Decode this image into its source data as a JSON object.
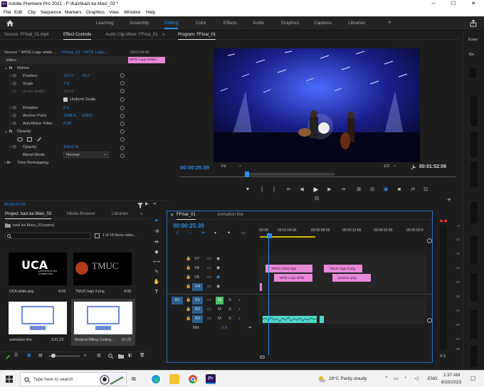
{
  "window": {
    "title": "Adobe Premiere Pro 2021 - F:\\Kazi\\kazi ka Masi_03 *",
    "app_icon": "Pr",
    "controls": [
      "─",
      "☐",
      "✕"
    ]
  },
  "menu": [
    "File",
    "Edit",
    "Clip",
    "Sequence",
    "Markers",
    "Graphics",
    "View",
    "Window",
    "Help"
  ],
  "workspaces": [
    {
      "label": "Learning"
    },
    {
      "label": "Assembly"
    },
    {
      "label": "Editing",
      "active": true
    },
    {
      "label": "Color"
    },
    {
      "label": "Effects"
    },
    {
      "label": "Audio"
    },
    {
      "label": "Graphics"
    },
    {
      "label": "Captions"
    },
    {
      "label": "Libraries"
    }
  ],
  "ws_more": "»",
  "ec": {
    "tabs": [
      "Source: FFinal_01.mp4",
      "Effect Controls",
      "Audio Clip Mixer: FFinal_01"
    ],
    "tabs_more": "»",
    "source": "Source * MITE Logo white ...",
    "sequence": "FFinal_01 * MITE Logo...",
    "tc_head": "00:01:04:00",
    "clip_chip": "MITE Logo white l",
    "video_label": "Video",
    "motion": "Motion",
    "position": {
      "label": "Position",
      "x": "101.0",
      "y": "23.0"
    },
    "scale": {
      "label": "Scale",
      "v": "7.0"
    },
    "scale_width": {
      "label": "Scale Width",
      "v": "100.0"
    },
    "uniform": "Uniform Scale",
    "rotation": {
      "label": "Rotation",
      "v": "0.0"
    },
    "anchor": {
      "label": "Anchor Point",
      "x": "1296.5",
      "y": "208.0"
    },
    "flicker": {
      "label": "Anti-flicker Filter",
      "v": "0.00"
    },
    "opacity": "Opacity",
    "opacity_val": {
      "label": "Opacity",
      "v": "100.0 %"
    },
    "blend": {
      "label": "Blend Mode",
      "v": "Normal"
    },
    "remap": "Time Remapping",
    "timecode": "00:00:25:39"
  },
  "program": {
    "tab": "Program: FFinal_01",
    "tc_left": "00:00:25:39",
    "fit": "Fit",
    "fraction": "1/2",
    "tc_right": "00:01:52:06"
  },
  "right_panel": {
    "label": "Esse",
    "sub": "Bn"
  },
  "project": {
    "tabs": [
      "Project: kazi ka Masi_03",
      "Media Browser",
      "Libraries"
    ],
    "tabs_more": "»",
    "path": "kazi ka Masi_03.prproj",
    "count": "1 of 18 Items selec...",
    "items": [
      {
        "name": "UCA white.png",
        "dur": "4;59",
        "art": "University for the Creative Arts"
      },
      {
        "name": "TMUC logo 3.png",
        "dur": "4;59",
        "art": "TMUC"
      },
      {
        "name": "animation line",
        "dur": "3;21;23"
      },
      {
        "name": "Medical Billing Coding...",
        "dur": "47;23"
      }
    ]
  },
  "timeline": {
    "tabs": [
      "FFinal_01",
      "animation line"
    ],
    "timecode": "00:00:25:39",
    "ruler": [
      ":00:00",
      "00:01:04:00",
      "00:02:08:00",
      "00:03:12:00",
      "00:04:16:00",
      "00:05:20:0"
    ],
    "tracks_v": [
      "V7",
      "V6",
      "V5",
      "V4"
    ],
    "tracks_a": [
      "A1",
      "A2",
      "A3"
    ],
    "src_patch": "A1",
    "mix": "Mix",
    "mix_val": "0.0",
    "clips": {
      "v6a": "TMUC white logo",
      "v6b": "TMUC logo 3.png",
      "v5a": "MITE Logo white",
      "v5b": "pearson.png"
    }
  },
  "meter": {
    "ticks": [
      "-6",
      "-12",
      "-18",
      "-24",
      "-30",
      "-36",
      "-42",
      "-48",
      "-54",
      "dB"
    ],
    "sm": "S S"
  },
  "taskbar": {
    "search": "Type here to search",
    "weather": "29°C  Partly cloudy",
    "lang": "ENG",
    "time": "1:37 AM",
    "date": "6/10/2023"
  },
  "colors": {
    "accent": "#2d8ceb",
    "clip_pink": "#e888d8",
    "audio_clip": "#4dd6c8",
    "timeline_border": "#2d6fc4"
  }
}
